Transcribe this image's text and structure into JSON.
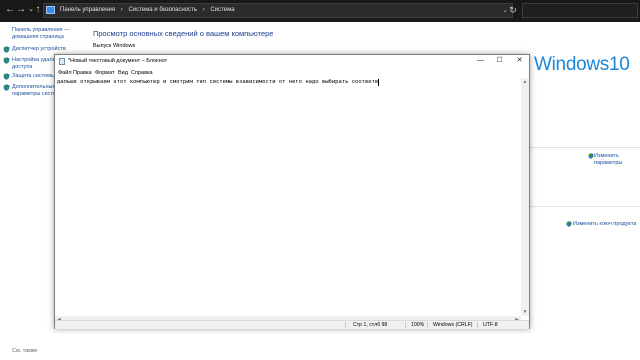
{
  "explorer": {
    "nav": {
      "back": "←",
      "forward": "→",
      "recent": "⌄",
      "up": "↑",
      "refresh": "↻"
    },
    "breadcrumbs": [
      "Панель управления",
      "›",
      "Система и безопасность",
      "›",
      "Система"
    ],
    "address_dropdown": "⌄"
  },
  "left_pane": {
    "home_link": "Панель управления — домашняя страница",
    "links": [
      {
        "label": "Диспетчер устройств",
        "icon": "shield-icon"
      },
      {
        "label": "Настройка удаленного доступа",
        "icon": "shield-icon"
      },
      {
        "label": "Защита системы",
        "icon": "shield-icon"
      },
      {
        "label": "Дополнительные параметры системы",
        "icon": "shield-icon"
      }
    ],
    "see_also": "См. также"
  },
  "main": {
    "title": "Просмотр основных сведений о вашем компьютере",
    "edition_label": "Выпуск Windows",
    "logo_text": "Windows10",
    "change_params": "Изменить параметры",
    "change_key": "Изменить ключ продукта"
  },
  "notepad": {
    "title": "*Новый текстовый документ – Блокнот",
    "controls": {
      "minimize": "—",
      "maximize": "☐",
      "close": "✕"
    },
    "menu": [
      "Файл",
      "Правка",
      "Формат",
      "Вид",
      "Справка"
    ],
    "content": "дальше открываем этот компьютер и смотрим тип системы взависимости от него надо выбирать соответв",
    "status": {
      "position": "Стр 1, стлб 98",
      "zoom": "100%",
      "line_endings": "Windows (CRLF)",
      "encoding": "UTF-8"
    }
  },
  "colors": {
    "explorer_bar": "#191919",
    "link": "#1b4f9b",
    "title": "#1e3d8f",
    "windows_logo": "#1c86d8",
    "shield_green": "#2e9a3a",
    "shield_blue": "#2f6fd6"
  }
}
